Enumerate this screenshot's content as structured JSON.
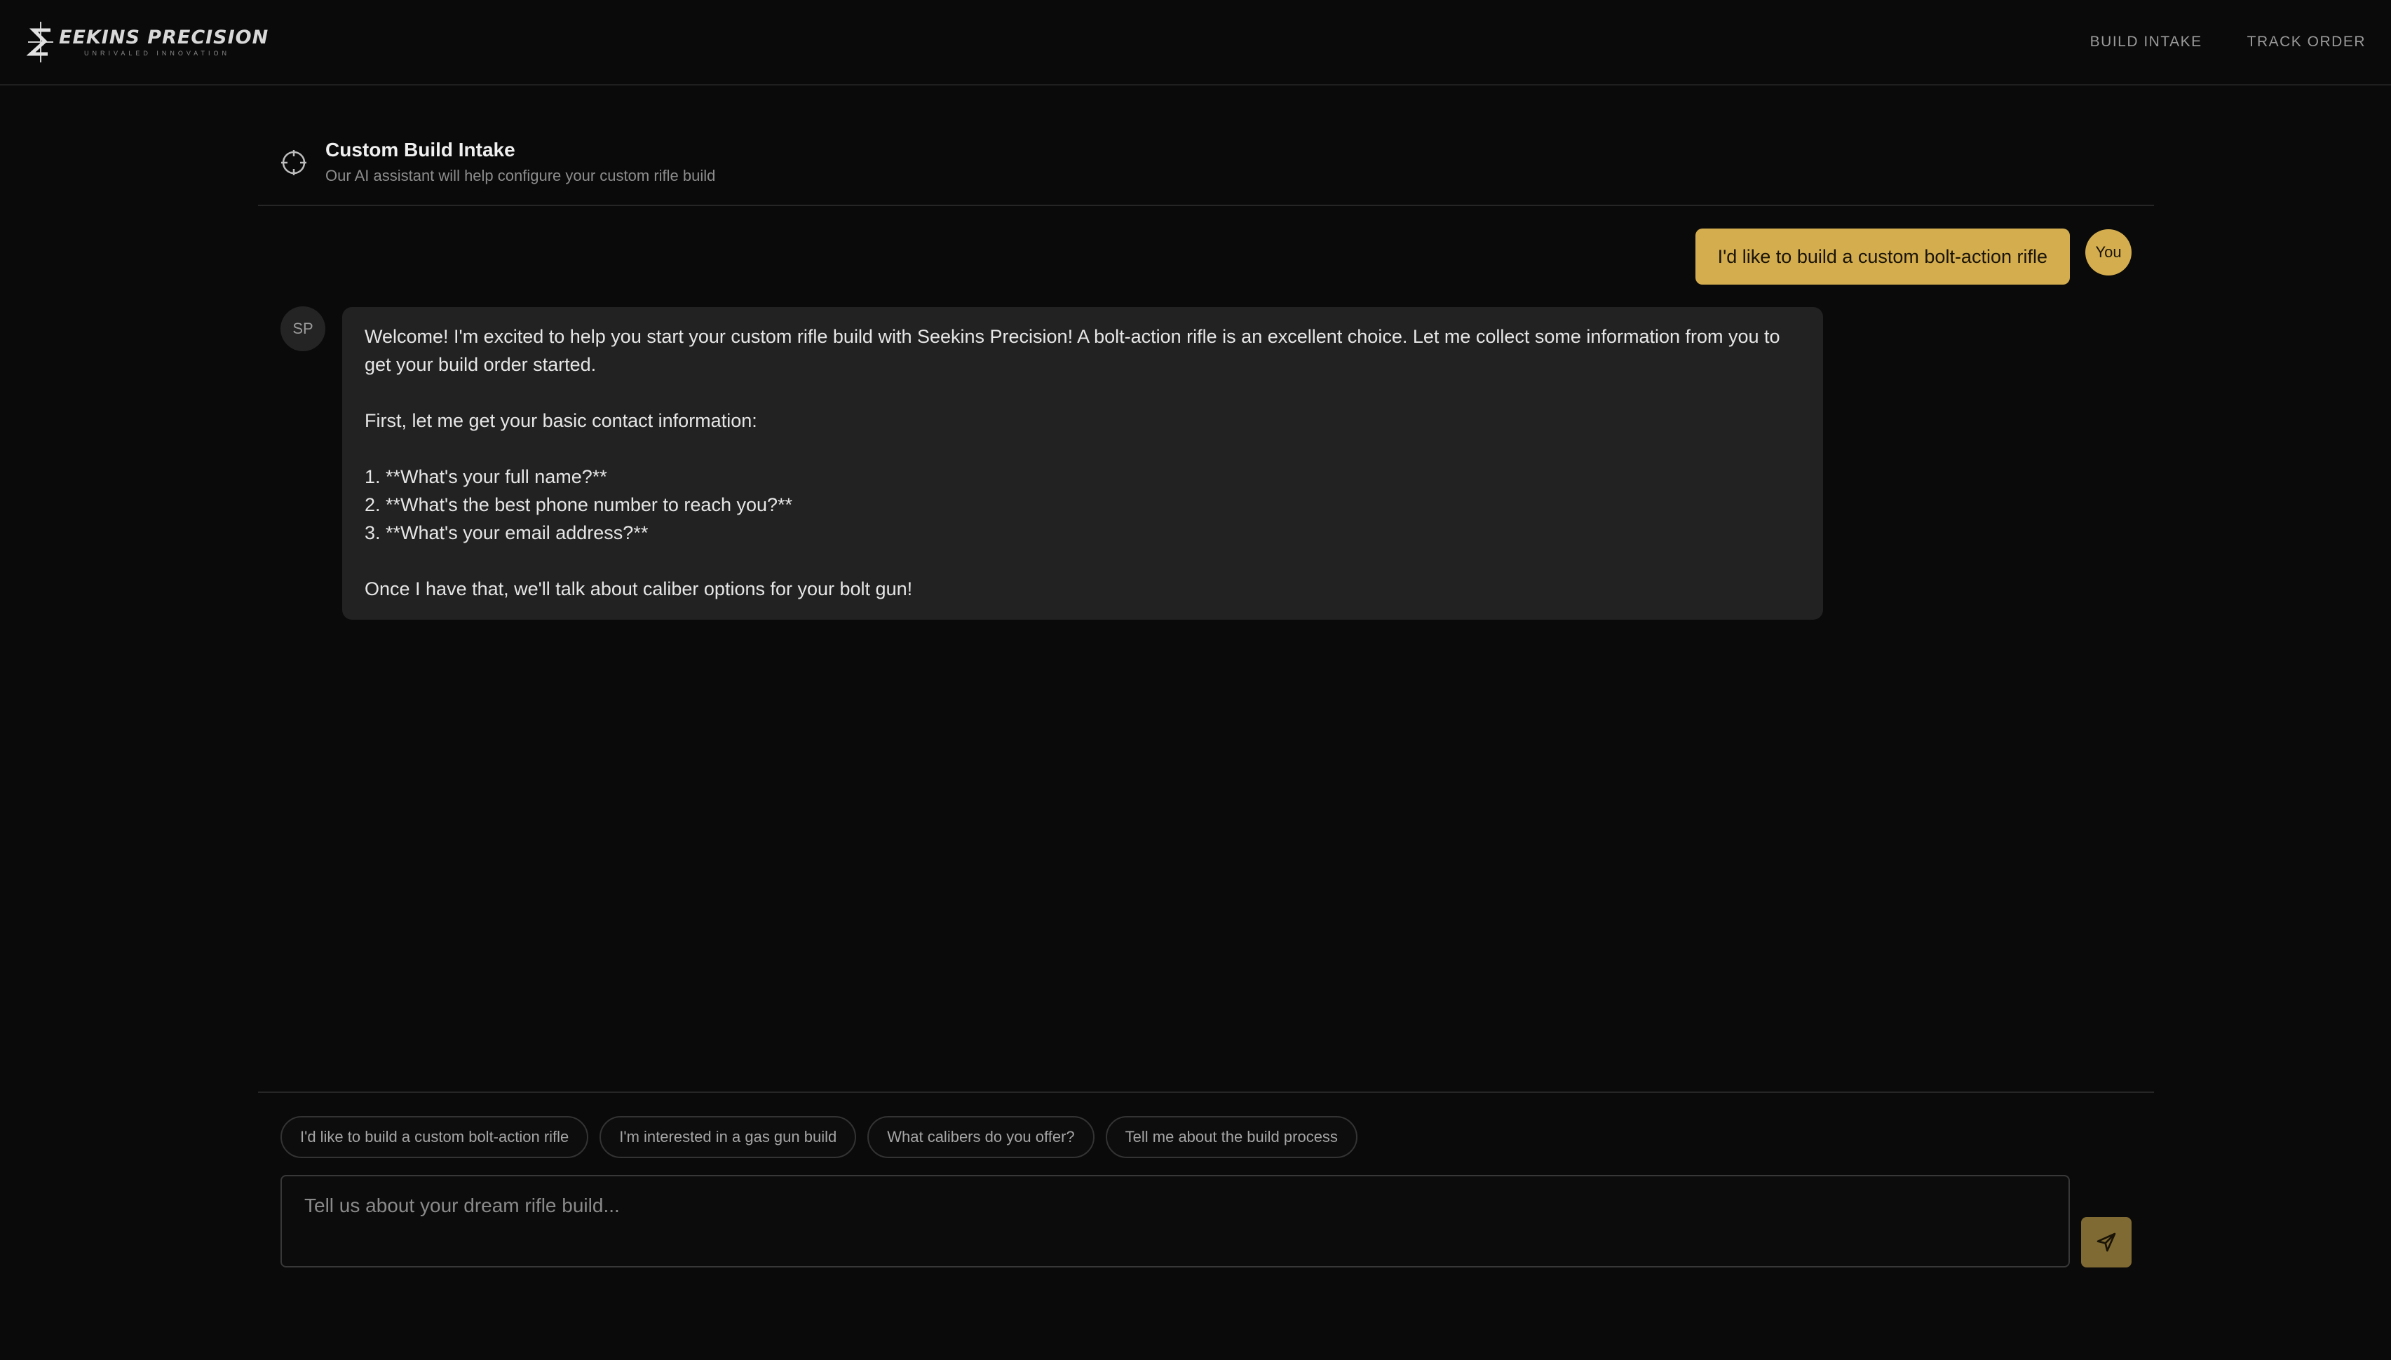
{
  "brand": {
    "name": "EEKINS PRECISION",
    "tagline": "UNRIVALED INNOVATION",
    "logo_icon": "seekins-s-logo-icon"
  },
  "nav": {
    "items": [
      {
        "label": "BUILD INTAKE"
      },
      {
        "label": "TRACK ORDER"
      }
    ]
  },
  "chat_header": {
    "icon": "crosshair-icon",
    "title": "Custom Build Intake",
    "subtitle": "Our AI assistant will help configure your custom rifle build"
  },
  "messages": {
    "user": {
      "avatar": "You",
      "text": "I'd like to build a custom bolt-action rifle"
    },
    "assistant": {
      "avatar": "SP",
      "lines": [
        "Welcome! I'm excited to help you start your custom rifle build with Seekins Precision! A bolt-action rifle is an excellent choice. Let me collect some information from you to get your build order started.",
        "First, let me get your basic contact information:",
        "1. **What's your full name?**",
        "2. **What's the best phone number to reach you?**",
        "3. **What's your email address?**",
        "Once I have that, we'll talk about caliber options for your bolt gun!"
      ]
    }
  },
  "suggestions": [
    {
      "label": "I'd like to build a custom bolt-action rifle"
    },
    {
      "label": "I'm interested in a gas gun build"
    },
    {
      "label": "What calibers do you offer?"
    },
    {
      "label": "Tell me about the build process"
    }
  ],
  "composer": {
    "placeholder": "Tell us about your dream rifle build...",
    "value": "",
    "send_icon": "send-icon"
  },
  "colors": {
    "background": "#0a0a0a",
    "accent": "#d4ad4f",
    "send_button": "#806a33",
    "assistant_bubble": "#222222"
  }
}
